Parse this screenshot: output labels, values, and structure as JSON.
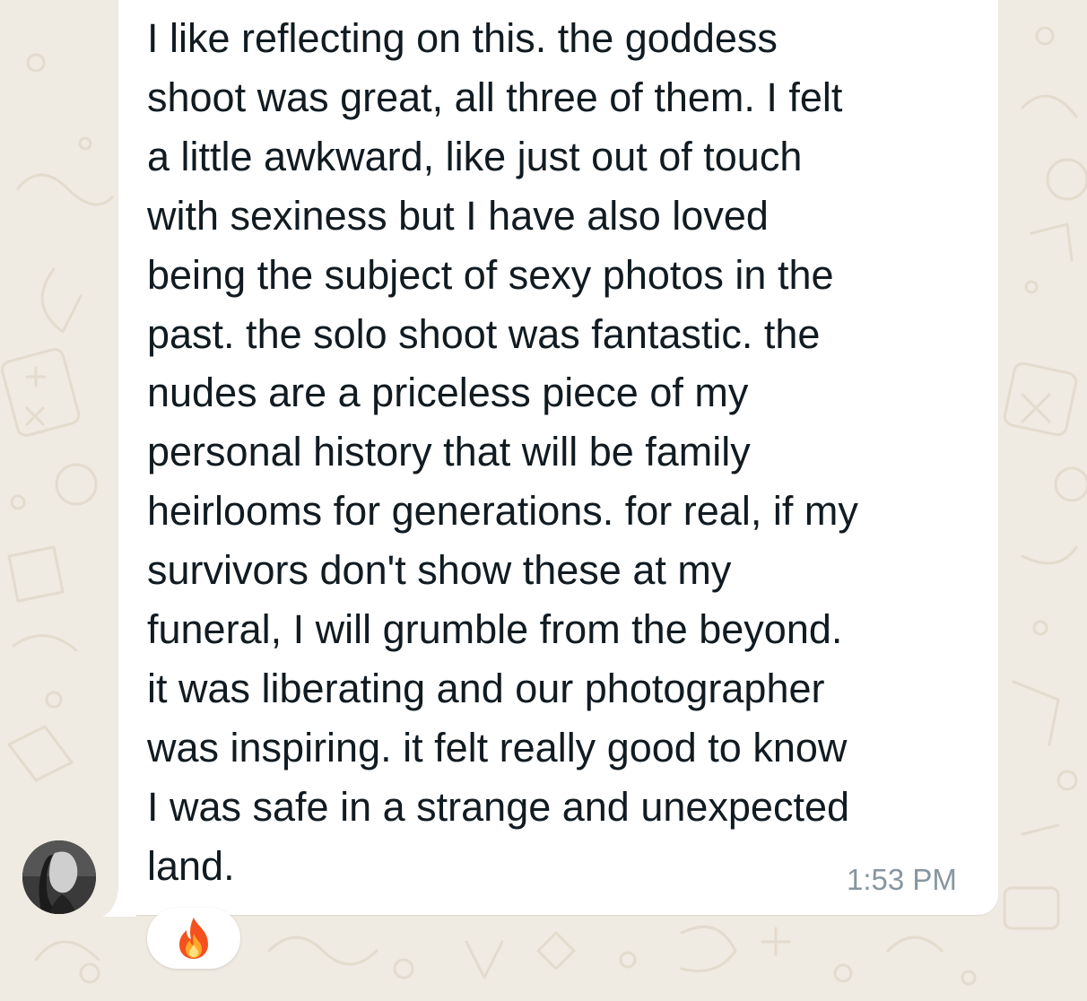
{
  "chat": {
    "message": {
      "text": "I like reflecting on this. the goddess\nshoot was great, all three of them. I felt\na little awkward, like just out of touch\nwith sexiness but I have also loved\nbeing the subject of sexy photos in the\npast. the solo shoot was fantastic. the\nnudes are a priceless piece of my\npersonal history that will be family\nheirlooms for generations. for real, if my\nsurvivors don't show these at my\nfuneral, I will grumble from the beyond.\nit was liberating and our photographer\nwas inspiring. it felt really good to know\nI was safe in a strange and unexpected\nland.",
      "time": "1:53 PM",
      "reaction": "fire"
    },
    "sender": {
      "avatar_icon": "profile-photo"
    }
  },
  "colors": {
    "wallpaper": "#efeae2",
    "bubble": "#ffffff",
    "text": "#111b21",
    "timestamp": "#8696a0"
  }
}
